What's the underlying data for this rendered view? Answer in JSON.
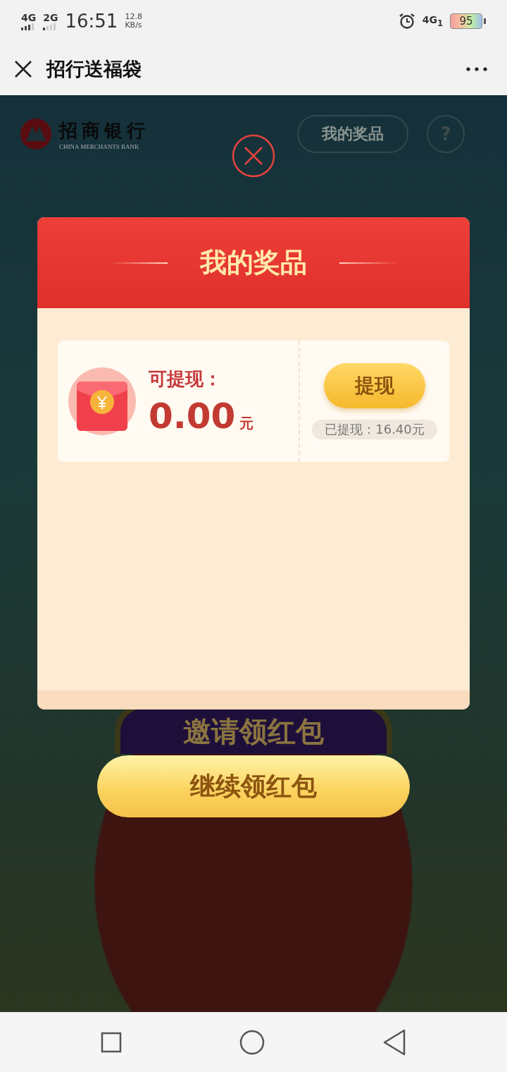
{
  "status_bar": {
    "network_1": "4G",
    "network_2": "2G",
    "time": "16:51",
    "speed": "12.8",
    "speed_unit": "KB/s",
    "network_3": "4G$_{1}$",
    "battery": "95"
  },
  "title_bar": {
    "title": "招行送福袋"
  },
  "page": {
    "logo_cn": "招商银行",
    "logo_en": "CHINA MERCHANTS BANK",
    "prizes_button": "我的奖品",
    "help_button": "?",
    "invite_button": "邀请领红包"
  },
  "dialog": {
    "title": "我的奖品",
    "label": "可提现：",
    "amount": "0.00",
    "unit": "元",
    "withdraw_button": "提现",
    "withdrawn": "已提现：16.40元"
  },
  "continue_button": "继续领红包"
}
